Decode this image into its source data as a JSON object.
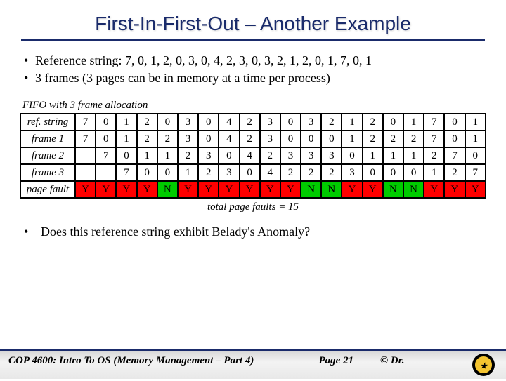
{
  "title": "First-In-First-Out – Another Example",
  "bullets": [
    "Reference string: 7, 0, 1, 2, 0, 3, 0, 4, 2, 3, 0, 3, 2, 1, 2, 0, 1, 7, 0, 1",
    "3 frames (3 pages can be in memory at a time per process)"
  ],
  "table_label": "FIFO with 3 frame allocation",
  "row_labels": [
    "ref. string",
    "frame 1",
    "frame 2",
    "frame 3",
    "page fault"
  ],
  "total_faults_label": "total page faults = 15",
  "question": "Does this reference string exhibit Belady's Anomaly?",
  "footer": {
    "course": "COP 4600: Intro To OS  (Memory Management – Part 4)",
    "page": "Page 21",
    "copy": "© Dr."
  },
  "chart_data": {
    "type": "table",
    "title": "FIFO with 3 frame allocation",
    "columns": 20,
    "ref_string": [
      7,
      0,
      1,
      2,
      0,
      3,
      0,
      4,
      2,
      3,
      0,
      3,
      2,
      1,
      2,
      0,
      1,
      7,
      0,
      1
    ],
    "frames": [
      [
        7,
        0,
        1,
        2,
        2,
        3,
        0,
        4,
        2,
        3,
        0,
        0,
        0,
        1,
        2,
        2,
        2,
        7,
        0,
        1
      ],
      [
        "",
        7,
        0,
        1,
        1,
        2,
        3,
        0,
        4,
        2,
        3,
        3,
        3,
        0,
        1,
        1,
        1,
        2,
        7,
        0
      ],
      [
        "",
        "",
        7,
        0,
        0,
        1,
        2,
        3,
        0,
        4,
        2,
        2,
        2,
        3,
        0,
        0,
        0,
        1,
        2,
        7
      ]
    ],
    "page_fault": [
      "Y",
      "Y",
      "Y",
      "Y",
      "N",
      "Y",
      "Y",
      "Y",
      "Y",
      "Y",
      "Y",
      "N",
      "N",
      "Y",
      "Y",
      "N",
      "N",
      "Y",
      "Y",
      "Y"
    ],
    "total_faults": 15
  }
}
